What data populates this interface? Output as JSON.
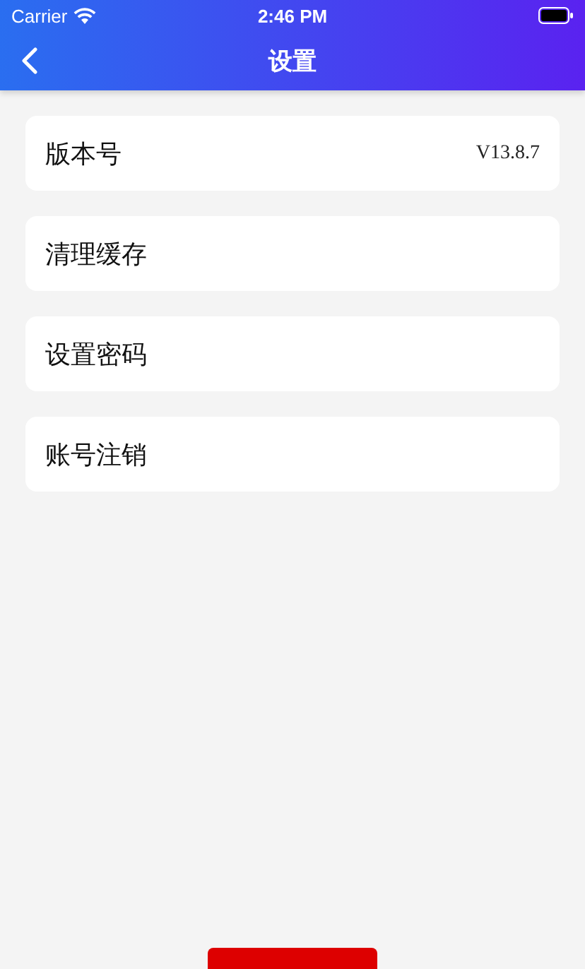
{
  "status_bar": {
    "carrier": "Carrier",
    "time": "2:46 PM"
  },
  "nav_bar": {
    "title": "设置"
  },
  "items": [
    {
      "label": "版本号",
      "value": "V13.8.7"
    },
    {
      "label": "清理缓存"
    },
    {
      "label": "设置密码"
    },
    {
      "label": "账号注销"
    }
  ]
}
